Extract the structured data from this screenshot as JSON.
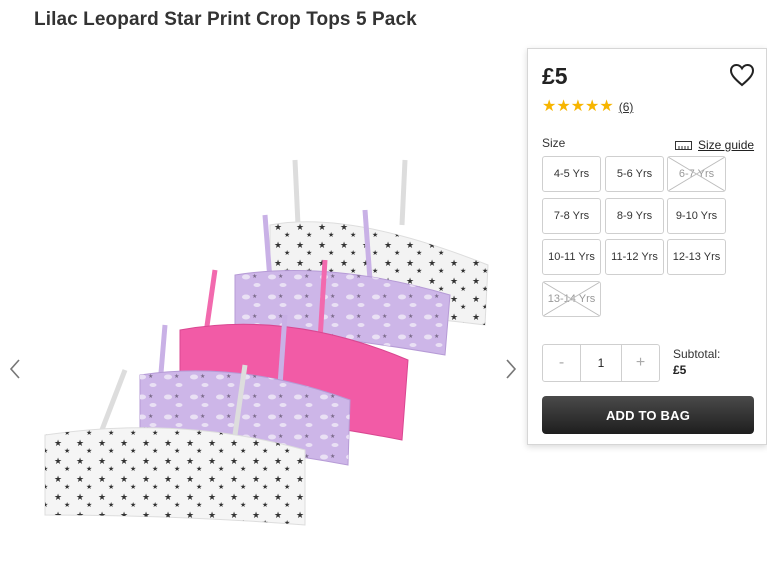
{
  "product": {
    "title": "Lilac Leopard Star Print Crop Tops 5 Pack",
    "price": "£5",
    "rating": 5,
    "review_count": "(6)"
  },
  "sizes": {
    "label": "Size",
    "guide_label": "Size guide",
    "options": [
      {
        "label": "4-5 Yrs",
        "available": true
      },
      {
        "label": "5-6 Yrs",
        "available": true
      },
      {
        "label": "6-7 Yrs",
        "available": false
      },
      {
        "label": "7-8 Yrs",
        "available": true
      },
      {
        "label": "8-9 Yrs",
        "available": true
      },
      {
        "label": "9-10 Yrs",
        "available": true
      },
      {
        "label": "10-11 Yrs",
        "available": true
      },
      {
        "label": "11-12 Yrs",
        "available": true
      },
      {
        "label": "12-13 Yrs",
        "available": true
      },
      {
        "label": "13-14 Yrs",
        "available": false
      }
    ]
  },
  "quantity": {
    "minus": "-",
    "value": "1",
    "plus": "+"
  },
  "subtotal": {
    "label": "Subtotal:",
    "value": "£5"
  },
  "add_to_bag_label": "ADD TO BAG",
  "icons": {
    "wishlist": "heart-icon",
    "prev": "chevron-left-icon",
    "next": "chevron-right-icon",
    "size_guide": "ruler-icon",
    "rating": "star-icon"
  },
  "colors": {
    "star": "#f7b500",
    "button": "#2a2a2a",
    "lilac": "#cbb4e6",
    "pink": "#f25da8",
    "white_top": "#f2f2f2"
  }
}
